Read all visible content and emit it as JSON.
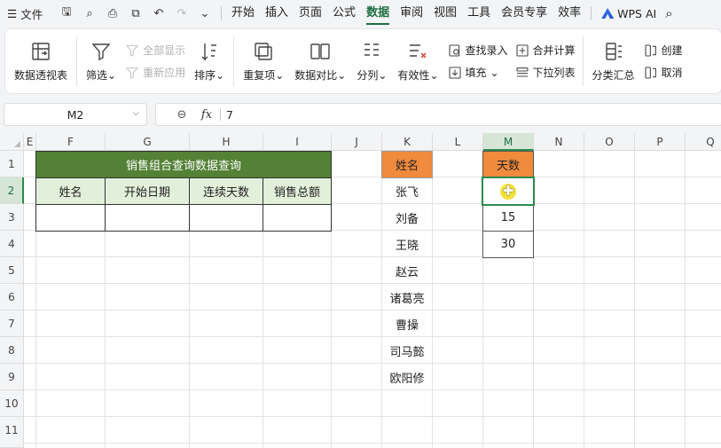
{
  "menubar": {
    "file_label": "文件",
    "tabs": [
      {
        "label": "开始"
      },
      {
        "label": "插入"
      },
      {
        "label": "页面"
      },
      {
        "label": "公式"
      },
      {
        "label": "数据",
        "active": true
      },
      {
        "label": "审阅"
      },
      {
        "label": "视图"
      },
      {
        "label": "工具"
      },
      {
        "label": "会员专享"
      },
      {
        "label": "效率"
      }
    ],
    "ai_label": "WPS AI"
  },
  "ribbon": {
    "pivot": "数据透视表",
    "filter": "筛选",
    "show_all": "全部显示",
    "reapply": "重新应用",
    "sort": "排序",
    "duplicates": "重复项",
    "compare": "数据对比",
    "split": "分列",
    "validity": "有效性",
    "lookup_entry": "查找录入",
    "fill": "填充",
    "consolidate": "合并计算",
    "dropdown_list": "下拉列表",
    "subtotal": "分类汇总",
    "create": "创建",
    "cancel": "取消"
  },
  "formula_bar": {
    "cell_ref": "M2",
    "fx": "fx",
    "value": "7"
  },
  "sheet": {
    "columns": [
      "E",
      "F",
      "G",
      "H",
      "I",
      "J",
      "K",
      "L",
      "M",
      "N",
      "O",
      "P",
      "Q"
    ],
    "rows": [
      "1",
      "2",
      "3",
      "4",
      "5",
      "6",
      "7",
      "8",
      "9",
      "10",
      "11"
    ],
    "selected_column": "M",
    "selected_row": "2",
    "query_title": "销售组合查询数据查询",
    "query_headers": [
      "姓名",
      "开始日期",
      "连续天数",
      "销售总额"
    ],
    "names_header": "姓名",
    "names": [
      "张飞",
      "刘备",
      "王晓",
      "赵云",
      "诸葛亮",
      "曹操",
      "司马懿",
      "欧阳修"
    ],
    "days_header": "天数",
    "days": [
      "",
      "15",
      "30"
    ]
  },
  "colors": {
    "accent": "#1f6e43",
    "title_fill": "#538135",
    "header_fill": "#e2efda",
    "orange_fill": "#f08a3c"
  }
}
